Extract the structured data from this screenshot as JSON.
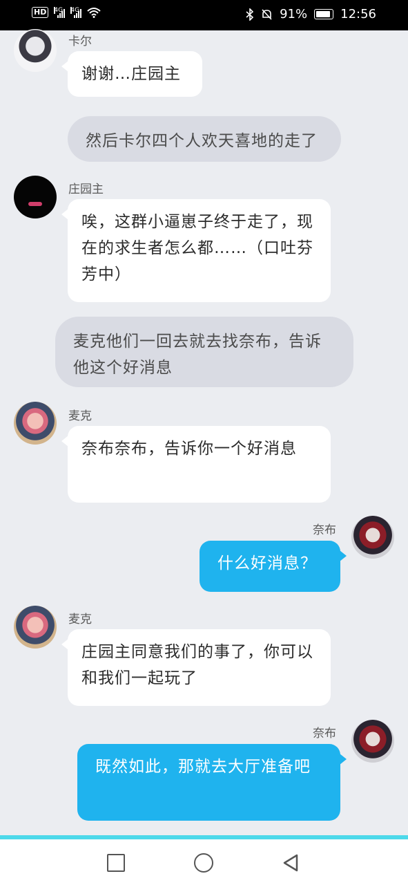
{
  "status_bar": {
    "hd_label": "HD",
    "network_1": "4G",
    "network_2": "4G",
    "battery_percent": "91%",
    "time": "12:56"
  },
  "messages": [
    {
      "type": "incoming",
      "sender": "卡尔",
      "text": "谢谢…庄园主"
    },
    {
      "type": "narration",
      "text": "然后卡尔四个人欢天喜地的走了"
    },
    {
      "type": "incoming",
      "sender": "庄园主",
      "text": "唉，这群小逼崽子终于走了，现在的求生者怎么都……（口吐芬芳中）"
    },
    {
      "type": "narration",
      "text": "麦克他们一回去就去找奈布，告诉他这个好消息"
    },
    {
      "type": "incoming",
      "sender": "麦克",
      "text": "奈布奈布，告诉你一个好消息"
    },
    {
      "type": "outgoing",
      "sender": "奈布",
      "text": "什么好消息？"
    },
    {
      "type": "incoming",
      "sender": "麦克",
      "text": "庄园主同意我们的事了，你可以和我们一起玩了"
    },
    {
      "type": "outgoing",
      "sender": "奈布",
      "text": "既然如此，那就去大厅准备吧"
    }
  ],
  "nav_bar": {
    "buttons": [
      "recent-apps",
      "home",
      "back"
    ]
  }
}
